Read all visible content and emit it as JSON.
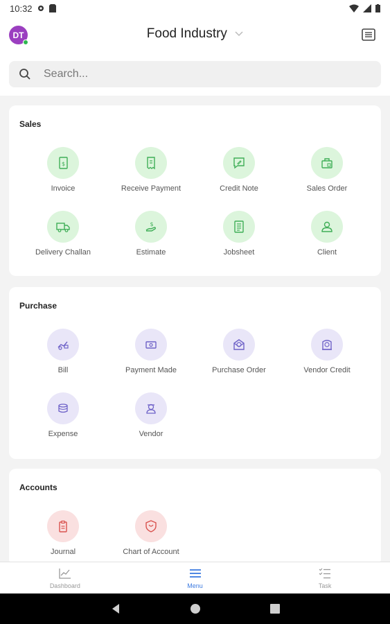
{
  "status": {
    "time": "10:32"
  },
  "header": {
    "avatar_initials": "DT",
    "org_name": "Food Industry"
  },
  "search": {
    "placeholder": "Search..."
  },
  "sections": {
    "sales": {
      "title": "Sales",
      "items": [
        {
          "label": "Invoice",
          "icon": "invoice-icon"
        },
        {
          "label": "Receive Payment",
          "icon": "receipt-icon"
        },
        {
          "label": "Credit Note",
          "icon": "credit-note-icon"
        },
        {
          "label": "Sales Order",
          "icon": "sales-order-icon"
        },
        {
          "label": "Delivery Challan",
          "icon": "delivery-truck-icon"
        },
        {
          "label": "Estimate",
          "icon": "estimate-icon"
        },
        {
          "label": "Jobsheet",
          "icon": "jobsheet-icon"
        },
        {
          "label": "Client",
          "icon": "client-icon"
        }
      ]
    },
    "purchase": {
      "title": "Purchase",
      "items": [
        {
          "label": "Bill",
          "icon": "bill-icon"
        },
        {
          "label": "Payment Made",
          "icon": "payment-made-icon"
        },
        {
          "label": "Purchase Order",
          "icon": "purchase-order-icon"
        },
        {
          "label": "Vendor Credit",
          "icon": "vendor-credit-icon"
        },
        {
          "label": "Expense",
          "icon": "expense-icon"
        },
        {
          "label": "Vendor",
          "icon": "vendor-icon"
        }
      ]
    },
    "accounts": {
      "title": "Accounts",
      "items": [
        {
          "label": "Journal",
          "icon": "journal-icon"
        },
        {
          "label": "Chart of Account",
          "icon": "chart-of-account-icon"
        }
      ]
    }
  },
  "bottom_nav": {
    "dashboard": "Dashboard",
    "menu": "Menu",
    "task": "Task"
  },
  "colors": {
    "sales_accent": "#3fae57",
    "purchase_accent": "#6f63c8",
    "accounts_accent": "#d9534f",
    "active_nav": "#3d7be0",
    "avatar": "#9b3fc0"
  }
}
